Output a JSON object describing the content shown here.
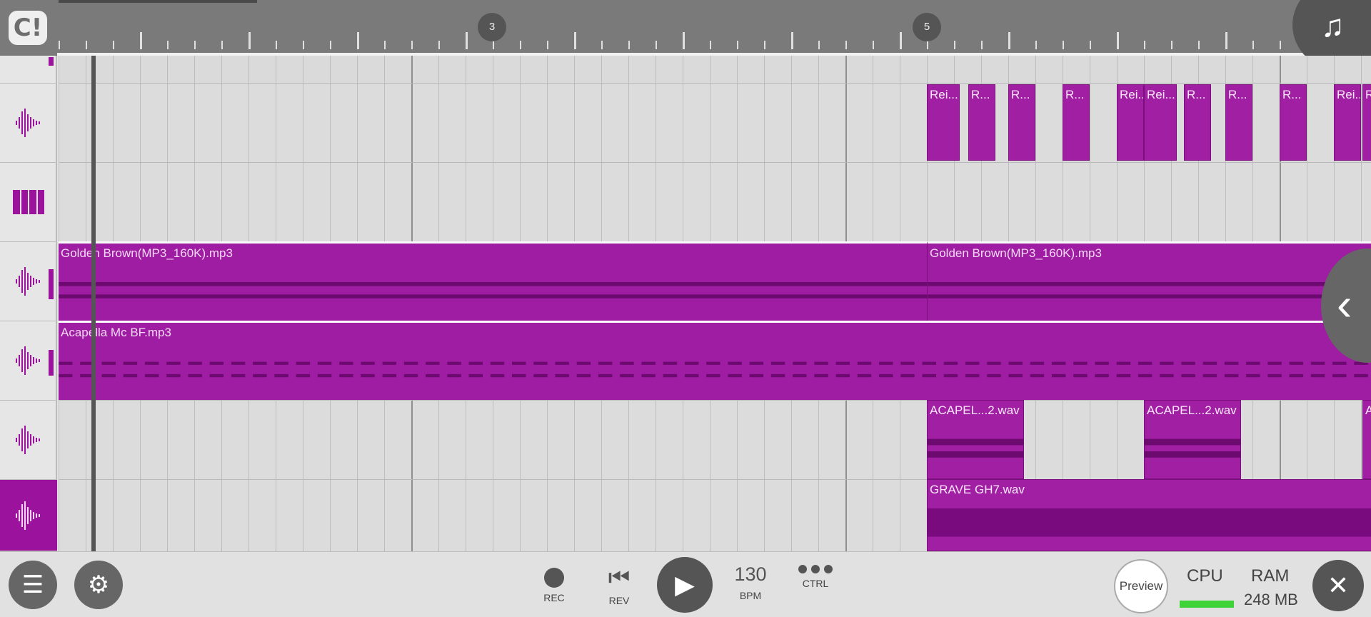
{
  "app": {
    "logo_text": "C!",
    "accent_color": "#9b139c"
  },
  "ruler": {
    "bar_markers": [
      "3",
      "5"
    ]
  },
  "tracks": [
    {
      "icon": "waveform-icon",
      "type": "audio"
    },
    {
      "icon": "piano-icon",
      "type": "instrument"
    },
    {
      "icon": "waveform-icon",
      "type": "audio"
    },
    {
      "icon": "waveform-icon",
      "type": "audio"
    },
    {
      "icon": "waveform-icon",
      "type": "audio"
    },
    {
      "icon": "waveform-icon",
      "type": "audio",
      "selected": true
    }
  ],
  "clips": {
    "track1": [
      "Rei...",
      "R...",
      "R...",
      "R...",
      "Rei...",
      "Rei...",
      "R...",
      "R...",
      "R...",
      "Rei...",
      "Rei..."
    ],
    "golden_brown_1": "Golden Brown(MP3_160K).mp3",
    "golden_brown_2": "Golden Brown(MP3_160K).mp3",
    "acapella": "Acapella Mc BF.mp3",
    "acapel_1": "ACAPEL...2.wav",
    "acapel_2": "ACAPEL...2.wav",
    "acapel_3": "A",
    "grave": "GRAVE GH7.wav"
  },
  "transport": {
    "rec_label": "REC",
    "rev_label": "REV",
    "bpm_value": "130",
    "bpm_label": "BPM",
    "ctrl_label": "CTRL",
    "preview_label": "Preview",
    "cpu_label": "CPU",
    "ram_label": "RAM",
    "ram_value": "248 MB"
  }
}
